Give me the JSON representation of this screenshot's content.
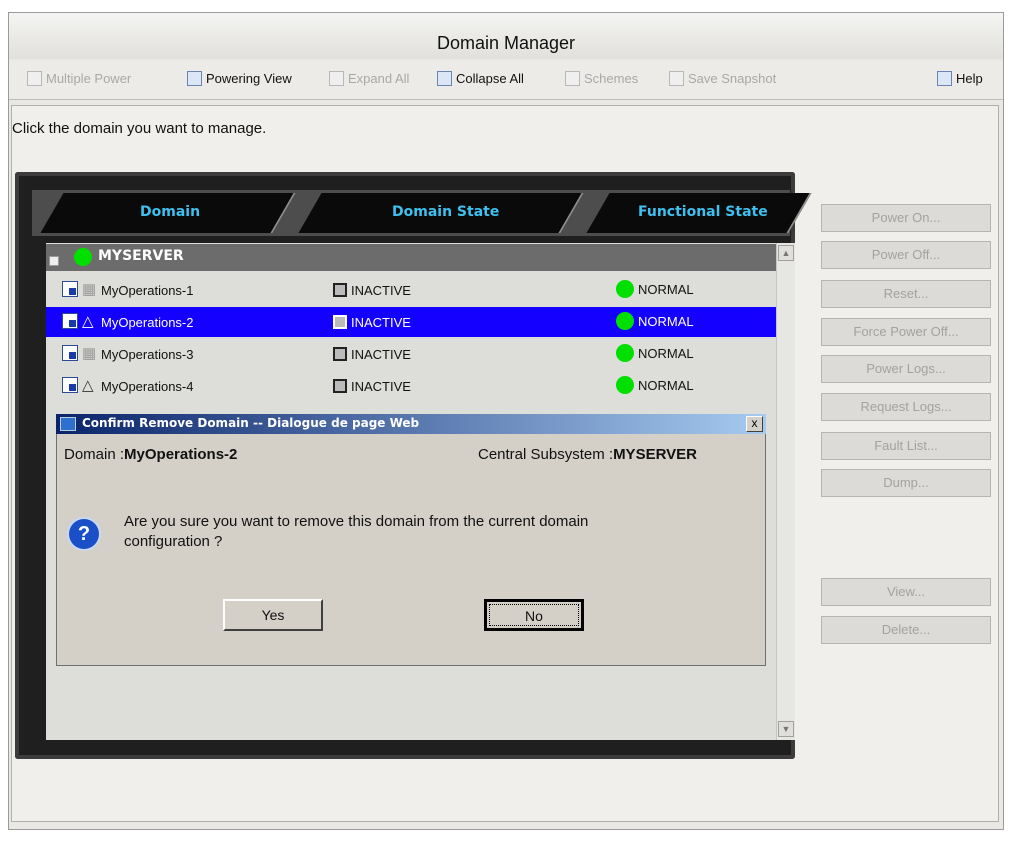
{
  "window": {
    "title": "Domain Manager"
  },
  "toolbar": {
    "multiple_power": "Multiple Power",
    "powering_view": "Powering View",
    "expand_all": "Expand All",
    "collapse_all": "Collapse All",
    "schemes": "Schemes",
    "save_snapshot": "Save Snapshot",
    "help": "Help"
  },
  "instruction": "Click the domain you want to manage.",
  "grid": {
    "columns": [
      "Domain",
      "Domain State",
      "Functional State"
    ],
    "server": "MYSERVER",
    "rows": [
      {
        "name": "MyOperations-1",
        "state": "INACTIVE",
        "functional": "NORMAL",
        "selected": false
      },
      {
        "name": "MyOperations-2",
        "state": "INACTIVE",
        "functional": "NORMAL",
        "selected": true
      },
      {
        "name": "MyOperations-3",
        "state": "INACTIVE",
        "functional": "NORMAL",
        "selected": false
      },
      {
        "name": "MyOperations-4",
        "state": "INACTIVE",
        "functional": "NORMAL",
        "selected": false
      }
    ]
  },
  "side_buttons": [
    "Power On...",
    "Power Off...",
    "Reset...",
    "Force Power Off...",
    "Power Logs...",
    "Request Logs...",
    "Fault List...",
    "Dump...",
    "View...",
    "Delete..."
  ],
  "dialog": {
    "title": "Confirm Remove Domain -- Dialogue de page Web",
    "domain_label": "Domain :",
    "domain_value": "MyOperations-2",
    "subsystem_label": "Central Subsystem :",
    "subsystem_value": "MYSERVER",
    "message_line1": "Are you sure you want to remove this domain from the current domain",
    "message_line2": "configuration ?",
    "yes": "Yes",
    "no": "No",
    "close": "x"
  },
  "colors": {
    "accent": "#3ec0f0",
    "selection": "#1300ff",
    "status_ok": "#00e000",
    "dialog_title": "#0a246a"
  }
}
